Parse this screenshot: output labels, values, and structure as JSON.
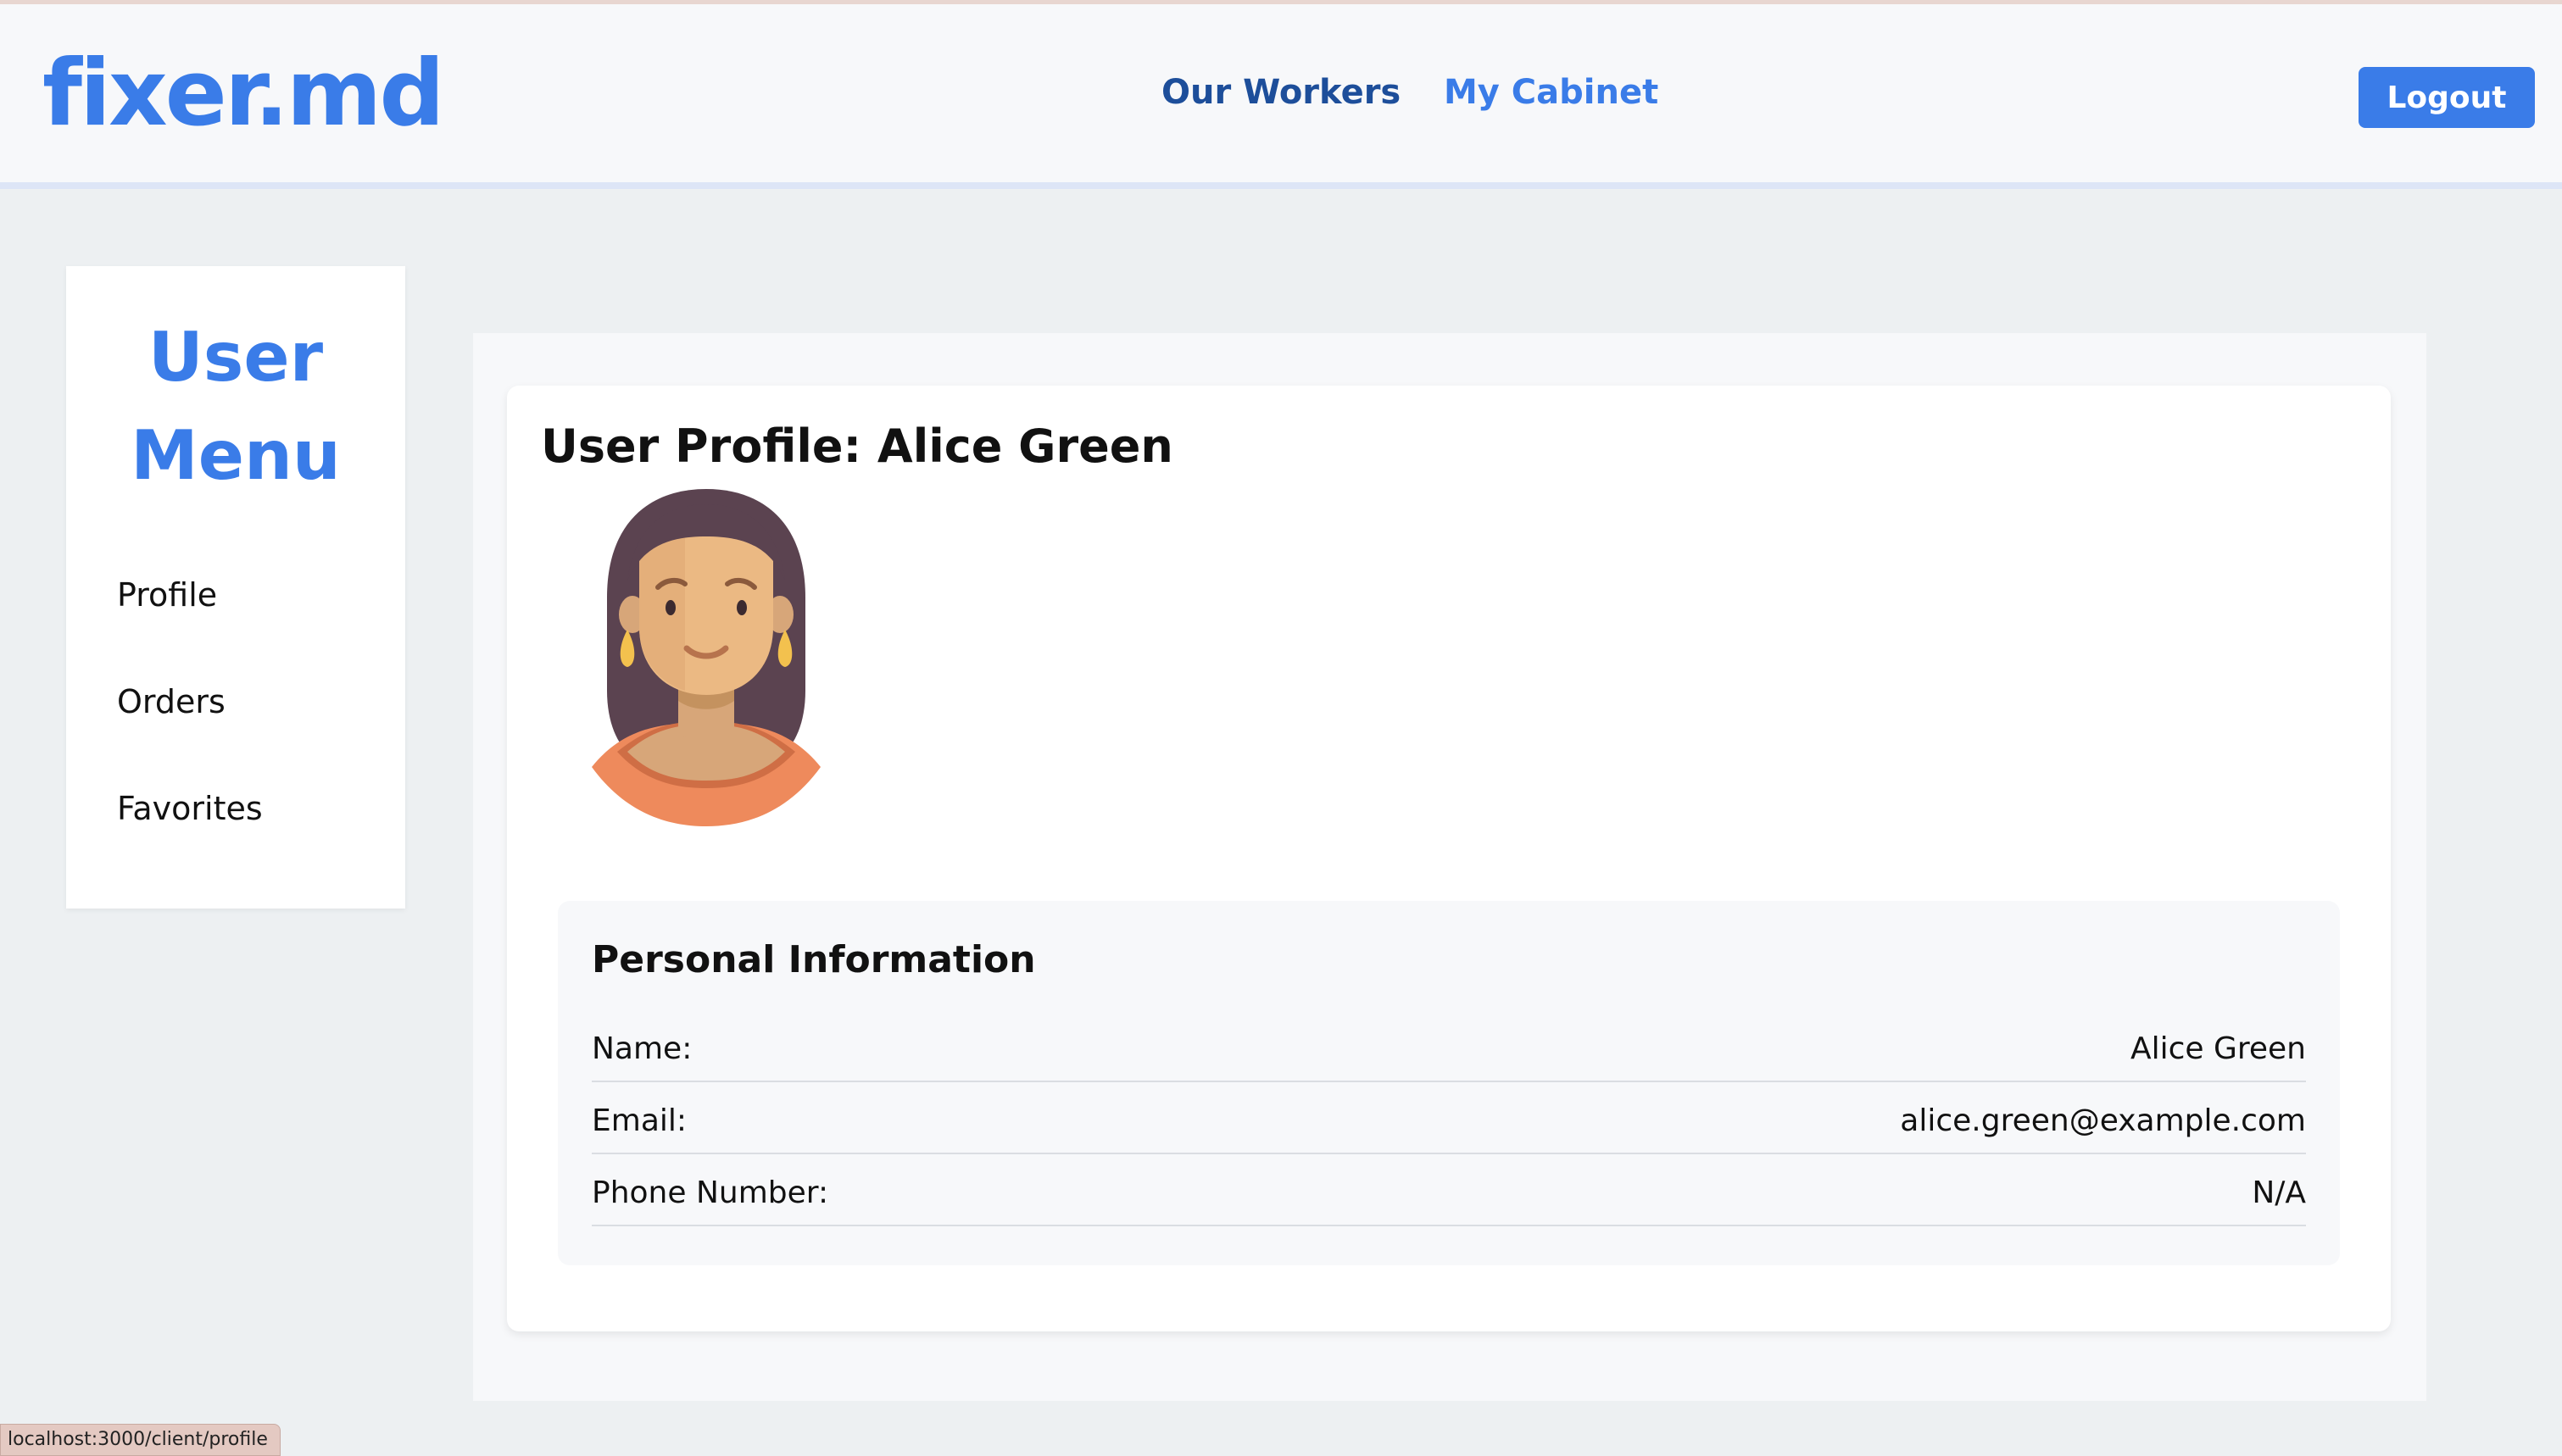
{
  "header": {
    "logo": "fixer.md",
    "nav": {
      "workers": "Our Workers",
      "cabinet": "My Cabinet"
    },
    "logout_label": "Logout"
  },
  "sidebar": {
    "title_line1": "User",
    "title_line2": "Menu",
    "items": [
      {
        "label": "Profile"
      },
      {
        "label": "Orders"
      },
      {
        "label": "Favorites"
      }
    ]
  },
  "profile": {
    "title": "User Profile: Alice Green",
    "avatar_icon": "avatar-woman-icon",
    "personal_info": {
      "heading": "Personal Information",
      "rows": [
        {
          "label": "Name:",
          "value": "Alice Green"
        },
        {
          "label": "Email:",
          "value": "alice.green@example.com"
        },
        {
          "label": "Phone Number:",
          "value": "N/A"
        }
      ]
    }
  },
  "status_bar": {
    "url": "localhost:3000/client/profile"
  },
  "colors": {
    "brand_blue": "#3a7ce8",
    "nav_dark_blue": "#1d4e9a",
    "page_bg": "#edf0f2"
  }
}
